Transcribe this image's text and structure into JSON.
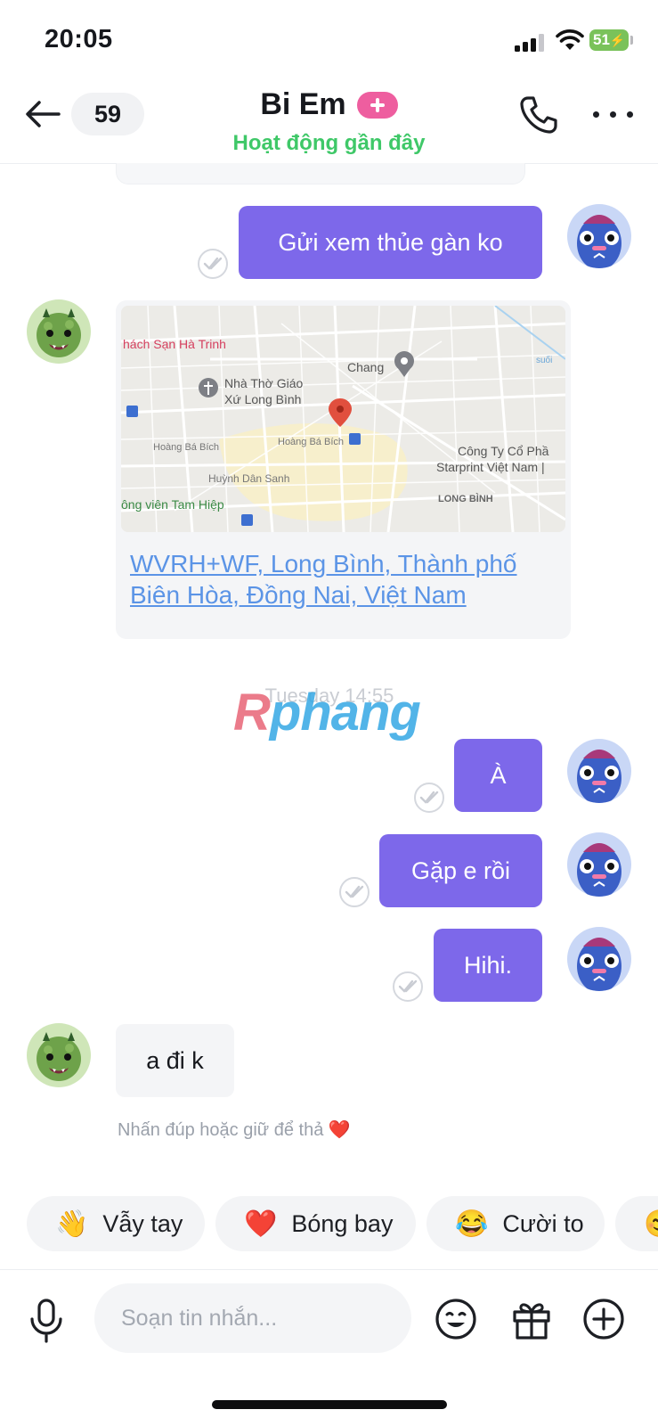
{
  "status_bar": {
    "time": "20:05",
    "battery": "51"
  },
  "header": {
    "unread_count": "59",
    "title": "Bi Em",
    "status": "Hoạt động gần đây"
  },
  "messages": [
    {
      "side": "out",
      "text": "Gửi xem thủe gàn ko",
      "seen": true
    },
    {
      "side": "in",
      "type": "location",
      "address": "WVRH+WF, Long Bình, Thành phố Biên Hòa, Đồng Nai, Việt Nam",
      "map_labels": {
        "hotel": "hách Sạn Hà Trinh",
        "chang": "Chang",
        "church_1": "Nhà Thờ Giáo",
        "church_2": "Xứ Long Bình",
        "street_1": "Hoàng Bá Bích",
        "street_2": "Hoàng Bá Bích",
        "street_3": "Huỳnh Dân Sanh",
        "company_1": "Công Ty Cổ Phầ",
        "company_2": "Starprint Việt Nam |",
        "district": "LONG BÌNH",
        "park": "ông viên Tam Hiệp",
        "river": "suối"
      }
    },
    {
      "type": "timestamp",
      "text": "Tuesday 14:55"
    },
    {
      "side": "out",
      "text": "À",
      "seen": true
    },
    {
      "side": "out",
      "text": "Gặp e rồi",
      "seen": true
    },
    {
      "side": "out",
      "text": "Hihi.",
      "seen": true
    },
    {
      "side": "in",
      "text": "a đi k"
    }
  ],
  "watermark": {
    "part1": "R",
    "part2": "phang"
  },
  "hint": {
    "text": "Nhấn đúp hoặc giữ để thả",
    "emoji": "❤️"
  },
  "quick_replies": [
    {
      "emoji": "👋",
      "label": "Vẫy tay"
    },
    {
      "emoji": "❤️",
      "label": "Bóng bay"
    },
    {
      "emoji": "😂",
      "label": "Cười to"
    },
    {
      "emoji": "😊",
      "label": ""
    }
  ],
  "composer": {
    "placeholder": "Soạn tin nhắn..."
  },
  "colors": {
    "outgoing_bubble": "#7d68ea",
    "incoming_bubble": "#f4f5f7",
    "status_green": "#3fc868",
    "plus_badge": "#ee5e9f",
    "link": "#5b94e6"
  },
  "icons": [
    "back-arrow-icon",
    "phone-icon",
    "more-icon",
    "seen-check-icon",
    "mic-icon",
    "emoji-icon",
    "gift-icon",
    "plus-circle-icon",
    "map-pin-icon"
  ]
}
